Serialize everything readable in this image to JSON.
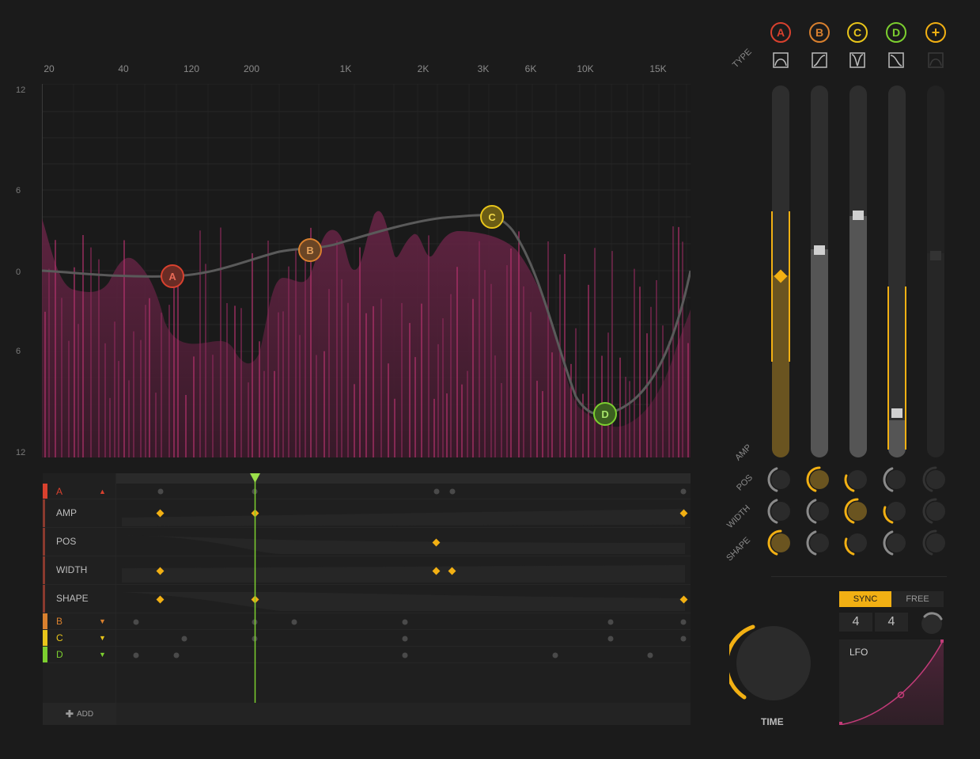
{
  "colors": {
    "background": "#1b1b1b",
    "accent": "#f2b013",
    "band_a": "#d9412e",
    "band_b": "#d9802e",
    "band_c": "#e8c51a",
    "band_d": "#7ccf2f",
    "spectrum": "#9c2e63",
    "playhead": "#7ccf2f"
  },
  "eq": {
    "freq_labels": [
      "20",
      "40",
      "120",
      "200",
      "1K",
      "2K",
      "3K",
      "6K",
      "10K",
      "15K"
    ],
    "db_labels": [
      "12",
      "6",
      "0",
      "6",
      "12"
    ],
    "nodes": [
      {
        "id": "A",
        "label": "A",
        "color": "#d9412e"
      },
      {
        "id": "B",
        "label": "B",
        "color": "#d9802e"
      },
      {
        "id": "C",
        "label": "C",
        "color": "#e8c51a"
      },
      {
        "id": "D",
        "label": "D",
        "color": "#7ccf2f"
      }
    ]
  },
  "bands": {
    "type_label": "TYPE",
    "amp_label": "AMP",
    "pos_label": "POS",
    "width_label": "WIDTH",
    "shape_label": "SHAPE",
    "items": [
      {
        "label": "A",
        "color": "#d9412e",
        "type_icon": "bell-filter-icon",
        "amp": 0.49
      },
      {
        "label": "B",
        "color": "#d9802e",
        "type_icon": "low-shelf-icon",
        "amp": 0.56
      },
      {
        "label": "C",
        "color": "#e8c51a",
        "type_icon": "notch-filter-icon",
        "amp": 0.65
      },
      {
        "label": "D",
        "color": "#7ccf2f",
        "type_icon": "high-shelf-icon",
        "amp": 0.1
      },
      {
        "label": "+",
        "color": "#f2b013",
        "type_icon": "bell-filter-icon",
        "amp": 0.55
      }
    ]
  },
  "timeline": {
    "rows": [
      {
        "label": "A",
        "color": "#d9412e",
        "arrow": "▲"
      },
      {
        "label": "AMP",
        "color": "#d9412e",
        "arrow": ""
      },
      {
        "label": "POS",
        "color": "#d9412e",
        "arrow": ""
      },
      {
        "label": "WIDTH",
        "color": "#d9412e",
        "arrow": ""
      },
      {
        "label": "SHAPE",
        "color": "#d9412e",
        "arrow": ""
      },
      {
        "label": "B",
        "color": "#d9802e",
        "arrow": "▼"
      },
      {
        "label": "C",
        "color": "#e8c51a",
        "arrow": "▼"
      },
      {
        "label": "D",
        "color": "#7ccf2f",
        "arrow": "▼"
      }
    ],
    "add_label": "ADD",
    "add_icon": "plus-icon"
  },
  "lfo": {
    "sync_label": "SYNC",
    "free_label": "FREE",
    "numerator": "4",
    "denominator": "4",
    "label": "LFO",
    "time_label": "TIME"
  }
}
